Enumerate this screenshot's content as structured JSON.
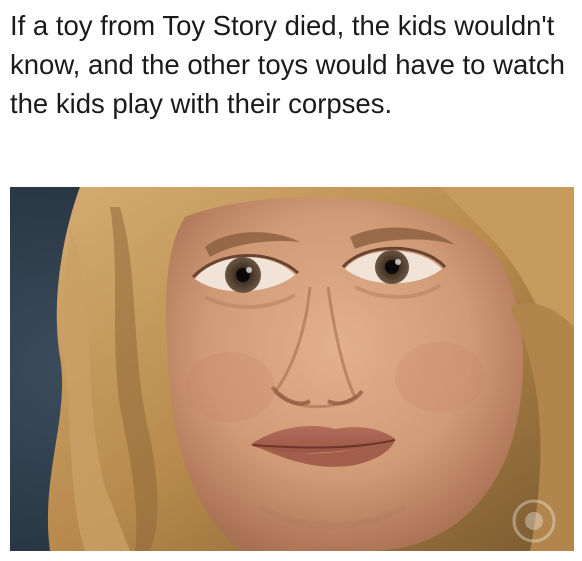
{
  "caption": {
    "text": "If a toy from Toy Story died, the kids wouldn't know, and the other toys would have to watch the kids play with their corpses."
  },
  "photo": {
    "subject": "woman-face-icon",
    "watermark": "channel-logo-icon"
  },
  "colors": {
    "background": "#ffffff",
    "caption_text": "#1a1a1a",
    "photo_backdrop": "#2d3a48",
    "hair": "#b98c4f",
    "skin": "#d7a07c"
  }
}
